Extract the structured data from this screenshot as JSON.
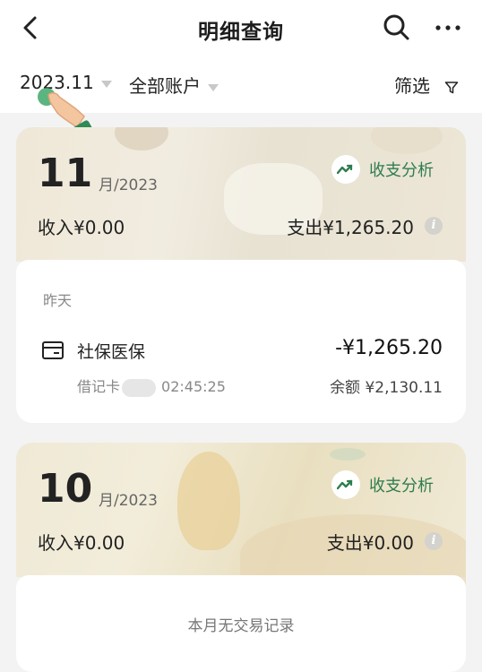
{
  "header": {
    "title": "明细查询",
    "back_icon": "chevron-left-icon",
    "search_icon": "search-icon",
    "more_icon": "more-horizontal-icon"
  },
  "filters": {
    "month": "2023.11",
    "account": "全部账户",
    "filter_label": "筛选",
    "filter_icon": "funnel-icon"
  },
  "colors": {
    "accent_green": "#2e7d4f",
    "background": "#f3f3f3"
  },
  "months": [
    {
      "month": "11",
      "year": "月/2023",
      "analysis_label": "收支分析",
      "income": "收入¥0.00",
      "expense": "支出¥1,265.20",
      "groups": [
        {
          "day": "昨天",
          "transactions": [
            {
              "name": "社保医保",
              "amount": "-¥1,265.20",
              "card": "借记卡",
              "time": "02:45:25",
              "balance": "余额 ¥2,130.11"
            }
          ]
        }
      ]
    },
    {
      "month": "10",
      "year": "月/2023",
      "analysis_label": "收支分析",
      "income": "收入¥0.00",
      "expense": "支出¥0.00",
      "empty_text": "本月无交易记录"
    }
  ]
}
